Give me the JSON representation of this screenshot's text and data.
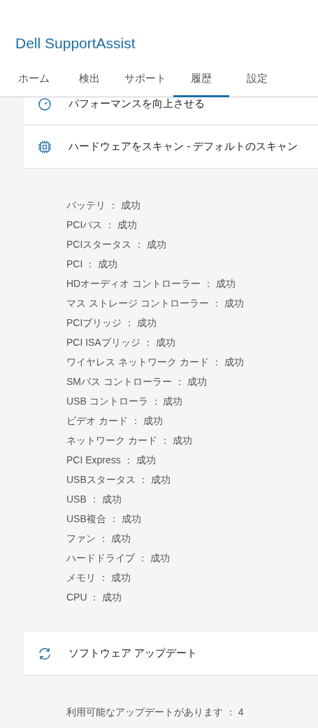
{
  "app_title": "Dell SupportAssist",
  "tabs": [
    {
      "label": "ホーム",
      "selected": false
    },
    {
      "label": "検出",
      "selected": false
    },
    {
      "label": "サポート",
      "selected": false
    },
    {
      "label": "履歴",
      "selected": true
    },
    {
      "label": "設定",
      "selected": false
    }
  ],
  "sections": [
    {
      "kind": "gauge",
      "title": "パフォーマンスを向上させる"
    },
    {
      "kind": "chip",
      "title": "ハードウェアをスキャン - デフォルトのスキャン",
      "details": [
        "バッテリ ： 成功",
        "PCIバス ： 成功",
        "PCIスタータス ： 成功",
        "PCI ： 成功",
        "HDオーディオ コントローラー ： 成功",
        "マス ストレージ コントローラー ： 成功",
        "PCIブリッジ ： 成功",
        "PCI ISAブリッジ ： 成功",
        "ワイヤレス ネットワーク カード ： 成功",
        "SMバス コントローラー ： 成功",
        "USB コントローラ ： 成功",
        "ビデオ カード ： 成功",
        "ネットワーク カード ： 成功",
        "PCI Express ： 成功",
        "USBスタータス ： 成功",
        "USB ： 成功",
        "USB複合 ： 成功",
        "ファン ： 成功",
        "ハードドライブ ： 成功",
        "メモリ ： 成功",
        "CPU ： 成功"
      ]
    },
    {
      "kind": "refresh",
      "title": "ソフトウェア アップデート",
      "details": [
        "利用可能なアップデートがあります ： 4"
      ]
    }
  ]
}
